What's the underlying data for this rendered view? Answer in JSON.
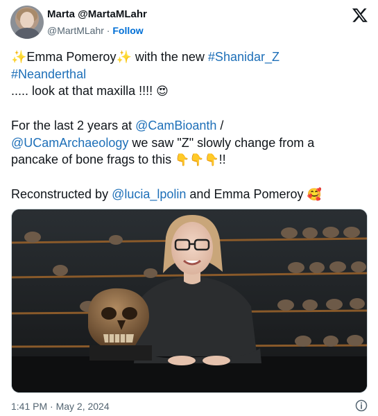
{
  "author": {
    "display_name": "Marta @MartaMLahr",
    "handle": "@MartMLahr",
    "separator": "·",
    "follow_label": "Follow"
  },
  "tweet": {
    "line1_pre": "✨Emma Pomeroy✨ with the new ",
    "hashtag1": "#Shanidar_Z",
    "hashtag2": "#Neanderthal",
    "line3": "..... look at that maxilla !!!! ",
    "emoji_heart_eyes": "😍",
    "line4_pre": "For the last 2 years at ",
    "mention1": "@CamBioanth",
    "line4_post": " /",
    "mention2": "@UCamArchaeology",
    "line5_post": " we saw \"Z\" slowly change from a",
    "line6_pre": "pancake of bone frags to this ",
    "pointing_emojis": "👇👇👇",
    "line6_post": "!!",
    "line7_pre": "Reconstructed by ",
    "mention3": "@lucia_lpolin",
    "line7_post": " and Emma Pomeroy ",
    "emoji_smiling_hearts": "🥰"
  },
  "media": {
    "type": "photo",
    "subject": "woman-with-skull",
    "background_color": "#1a1a1a",
    "sweater_color": "#2b2d2f",
    "skull_color": "#8a6a48"
  },
  "footer": {
    "timestamp": "1:41 PM · May 2, 2024"
  },
  "icons": {
    "brand": "x-logo-icon",
    "info": "info-icon"
  },
  "colors": {
    "link": "#1d6fb8",
    "follow": "#006fd6",
    "secondary_text": "#536471",
    "primary_text": "#0f1419"
  }
}
